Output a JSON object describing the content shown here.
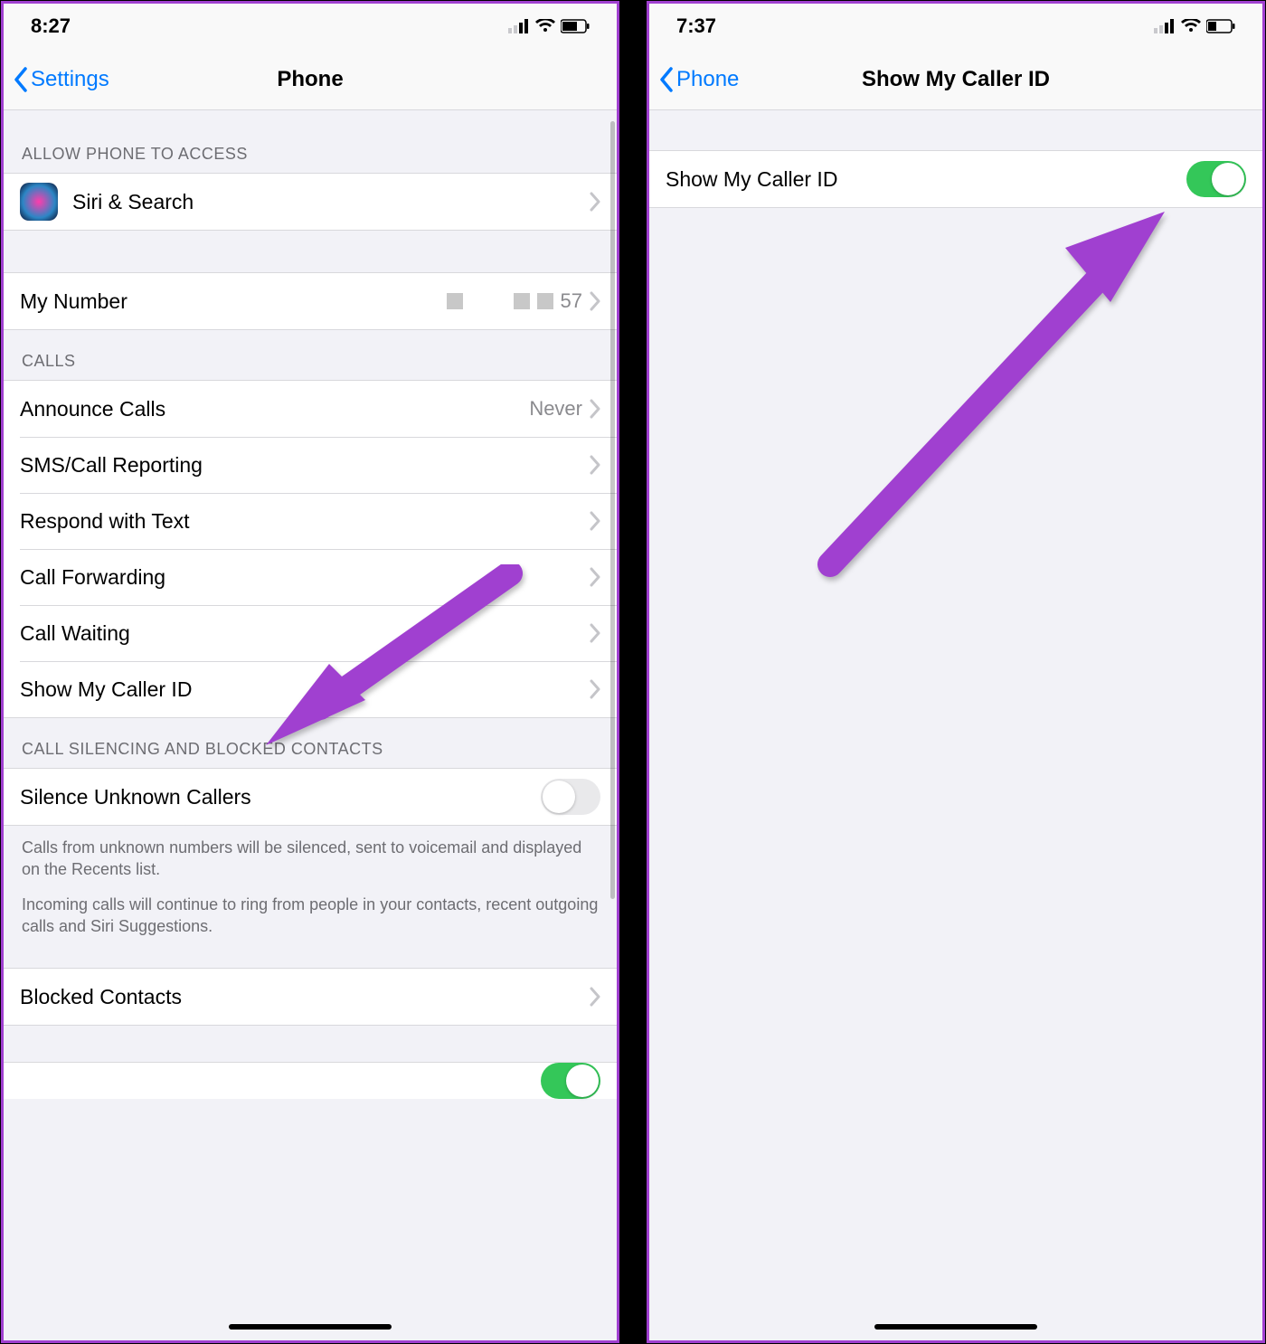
{
  "left": {
    "status_time": "8:27",
    "nav_back": "Settings",
    "nav_title": "Phone",
    "sect_access": "ALLOW PHONE TO ACCESS",
    "row_siri": "Siri & Search",
    "row_mynum": "My Number",
    "mynum_suffix": "57",
    "sect_calls": "CALLS",
    "row_announce": "Announce Calls",
    "announce_val": "Never",
    "row_sms": "SMS/Call Reporting",
    "row_respond": "Respond with Text",
    "row_fwd": "Call Forwarding",
    "row_wait": "Call Waiting",
    "row_caller": "Show My Caller ID",
    "sect_silence": "CALL SILENCING AND BLOCKED CONTACTS",
    "row_silence": "Silence Unknown Callers",
    "silence_desc1": "Calls from unknown numbers will be silenced, sent to voicemail and displayed on the Recents list.",
    "silence_desc2": "Incoming calls will continue to ring from people in your contacts, recent outgoing calls and Siri Suggestions.",
    "row_blocked": "Blocked Contacts"
  },
  "right": {
    "status_time": "7:37",
    "nav_back": "Phone",
    "nav_title": "Show My Caller ID",
    "row_caller": "Show My Caller ID"
  }
}
